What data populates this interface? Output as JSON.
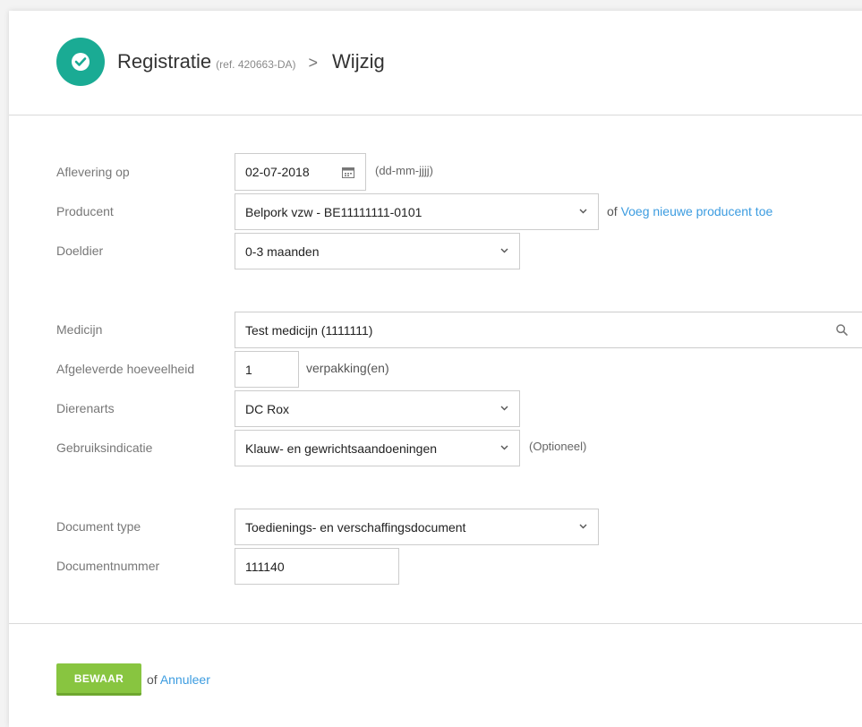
{
  "header": {
    "title": "Registratie",
    "ref": "(ref. 420663-DA)",
    "breadcrumb_separator": ">",
    "subtitle": "Wijzig",
    "status_icon": "check-icon",
    "accent_color": "#1aab94"
  },
  "form": {
    "delivery_date": {
      "label": "Aflevering op",
      "value": "02-07-2018",
      "hint": "(dd-mm-jjjj)"
    },
    "producer": {
      "label": "Producent",
      "value": "Belpork vzw - BE11111111-0101",
      "or": "of",
      "add_link": "Voeg nieuwe producent toe"
    },
    "target_animal": {
      "label": "Doeldier",
      "value": "0-3 maanden"
    },
    "medicine": {
      "label": "Medicijn",
      "value": "Test medicijn (1111111)"
    },
    "quantity": {
      "label": "Afgeleverde hoeveelheid",
      "value": "1",
      "unit": "verpakking(en)"
    },
    "vet": {
      "label": "Dierenarts",
      "value": "DC Rox"
    },
    "usage": {
      "label": "Gebruiksindicatie",
      "value": "Klauw- en gewrichtsaandoeningen",
      "hint": "(Optioneel)"
    },
    "document_type": {
      "label": "Document type",
      "value": "Toedienings- en verschaffingsdocument"
    },
    "document_number": {
      "label": "Documentnummer",
      "value": "111140"
    }
  },
  "actions": {
    "save_label": "BEWAAR",
    "or": "of",
    "cancel_label": "Annuleer",
    "save_color": "#88c540",
    "link_color": "#3c9ce0"
  }
}
